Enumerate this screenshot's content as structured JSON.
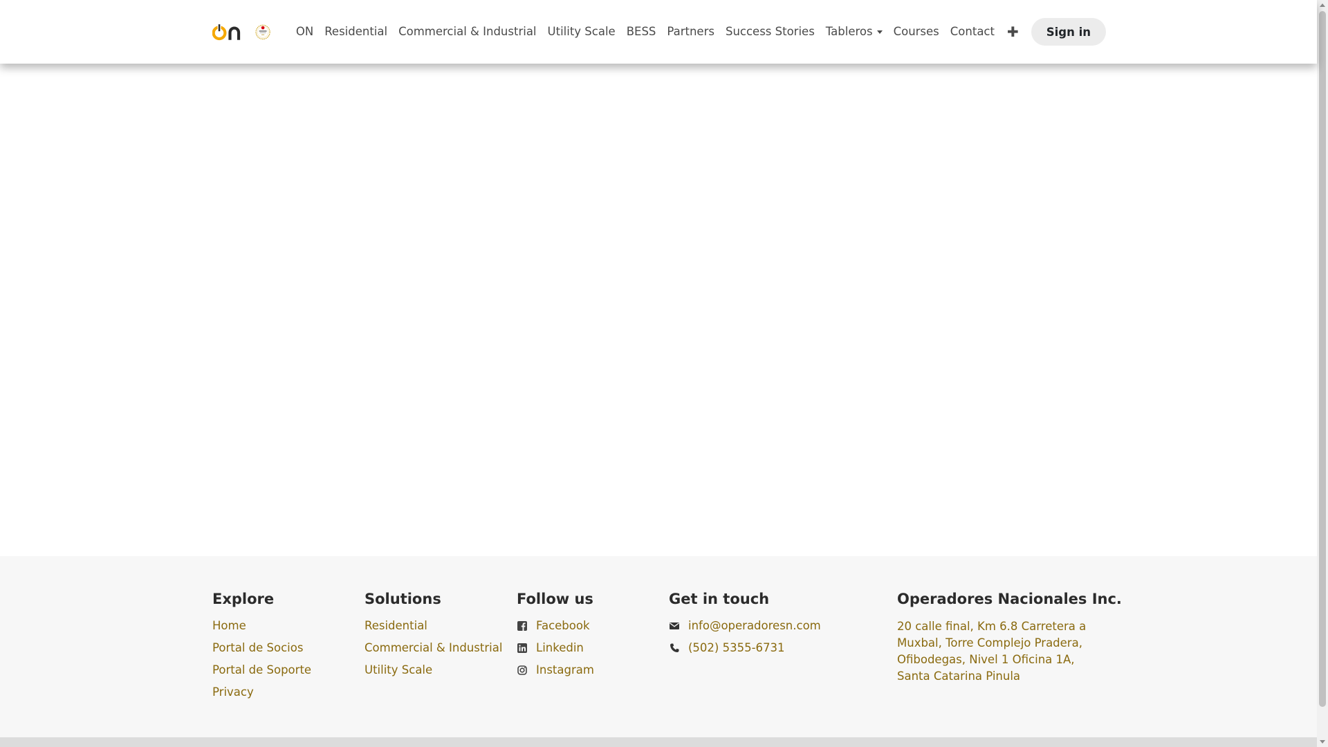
{
  "header": {
    "nav": [
      {
        "label": "ON"
      },
      {
        "label": "Residential"
      },
      {
        "label": "Commercial & Industrial"
      },
      {
        "label": "Utility Scale"
      },
      {
        "label": "BESS"
      },
      {
        "label": "Partners"
      },
      {
        "label": "Success Stories"
      },
      {
        "label": "Tableros",
        "dropdown": true
      },
      {
        "label": "Courses"
      },
      {
        "label": "Contact"
      }
    ],
    "plus_icon": "plus-icon",
    "signin_label": "Sign in"
  },
  "footer": {
    "explore": {
      "title": "Explore",
      "links": [
        "Home",
        "Portal de Socios",
        "Portal de Soporte",
        "Privacy"
      ]
    },
    "solutions": {
      "title": "Solutions",
      "links": [
        "Residential",
        "Commercial & Industrial",
        "Utility Scale"
      ]
    },
    "follow": {
      "title": "Follow us",
      "links": [
        {
          "label": "Facebook",
          "icon": "facebook-icon"
        },
        {
          "label": "Linkedin",
          "icon": "linkedin-icon"
        },
        {
          "label": "Instagram",
          "icon": "instagram-icon"
        }
      ]
    },
    "contact": {
      "title": "Get in touch",
      "email": "info@operadoresn.com",
      "phone": "(502) 5355-6731"
    },
    "company": {
      "title": "Operadores Nacionales Inc.",
      "address": "20 calle final, Km 6.8 Carretera a Muxbal, Torre Complejo Pradera, Ofibodegas, Nivel 1 Oficina 1A, Santa Catarina Pinula"
    }
  },
  "colors": {
    "link": "#8a6a0f",
    "brand_yellow": "#f5a800",
    "brand_dark": "#2b2b2b",
    "footer_bg": "#f7f7f7"
  }
}
